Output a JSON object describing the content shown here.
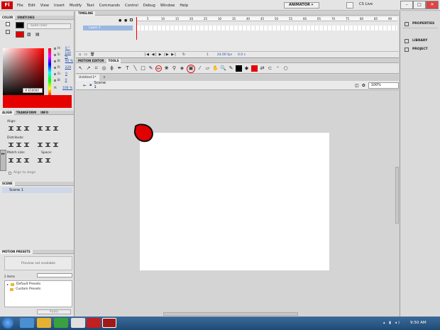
{
  "app": {
    "logo_text": "Fl",
    "menu": [
      "File",
      "Edit",
      "View",
      "Insert",
      "Modify",
      "Text",
      "Commands",
      "Control",
      "Debug",
      "Window",
      "Help"
    ],
    "workspace": "ANIMATOR ▾",
    "cs_live": "CS Live"
  },
  "color_panel": {
    "tabs": [
      "COLOR",
      "SWATCHES"
    ],
    "type": "Solid color",
    "hsb": [
      {
        "label": "H:",
        "value": "0 °"
      },
      {
        "label": "S:",
        "value": "100 %"
      },
      {
        "label": "B:",
        "value": "90 %"
      },
      {
        "label": "R:",
        "value": "229"
      },
      {
        "label": "G:",
        "value": "0"
      },
      {
        "label": "B:",
        "value": "0"
      }
    ],
    "alpha_label": "A:",
    "alpha_value": "100 %",
    "hex": "# E50000",
    "fill_color": "#e60000"
  },
  "align_panel": {
    "tabs": [
      "ALIGN",
      "TRANSFORM",
      "INFO"
    ],
    "align_label": "Align:",
    "distribute_label": "Distribute:",
    "match_label": "Match size:",
    "space_label": "Space:",
    "align_stage": "Align to stage"
  },
  "scene_panel": {
    "title": "SCENE",
    "item": "Scene 1"
  },
  "motion_presets": {
    "title": "MOTION PRESETS",
    "preview": "Preview not available",
    "count": "2 items",
    "folders": [
      "Default Presets",
      "Custom Presets"
    ],
    "apply": "Apply"
  },
  "timeline": {
    "title": "TIMELINE",
    "layer": "Layer 1",
    "ticks": [
      "5",
      "10",
      "15",
      "20",
      "25",
      "30",
      "35",
      "40",
      "45",
      "50",
      "55",
      "60",
      "65",
      "70",
      "75",
      "80",
      "85",
      "90"
    ],
    "fps": "24.00 fps",
    "time": "0.0 s",
    "frame": "1"
  },
  "tools_tabs": [
    "MOTION EDITOR",
    "TOOLS"
  ],
  "document": {
    "tab": "Untitled-1*",
    "scene": "Scene 1",
    "zoom": "100%"
  },
  "right_panel": [
    "PROPERTIES",
    "LIBRARY",
    "PROJECT"
  ],
  "taskbar": {
    "time": "9:50 AM"
  }
}
